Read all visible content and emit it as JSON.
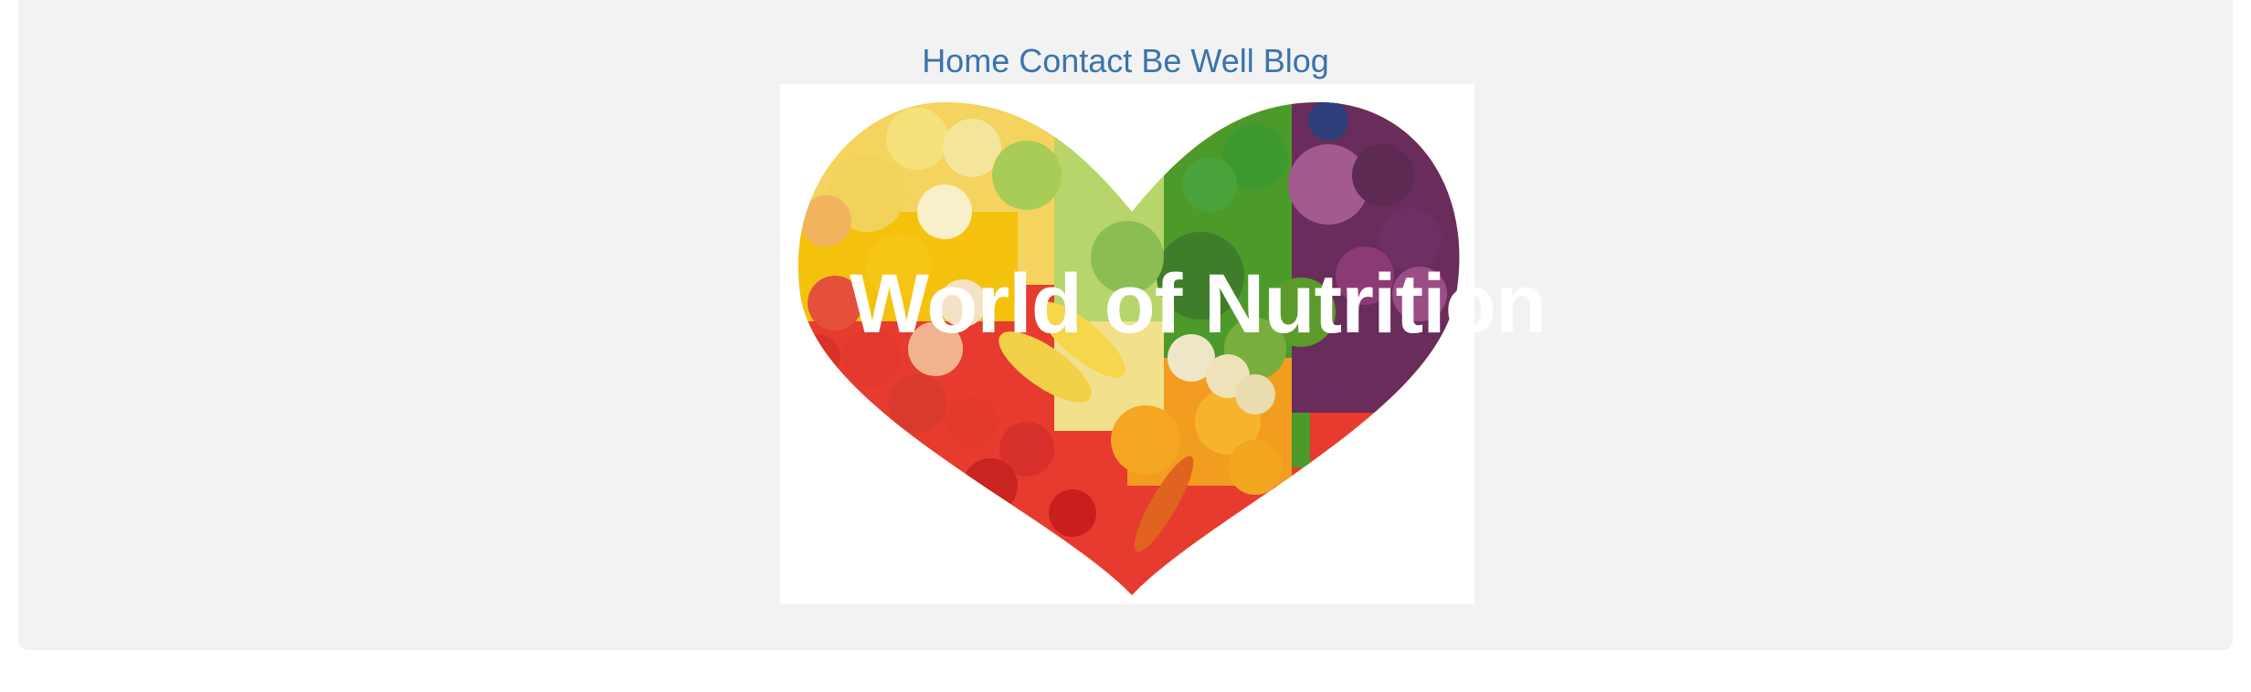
{
  "nav": {
    "home_label": "Home",
    "contact_label": "Contact",
    "bewell_label": "Be Well",
    "blog_label": "Blog"
  },
  "hero": {
    "title": "World of Nutrition",
    "image_icon": "fruit-vegetable-heart-image"
  },
  "colors": {
    "jumbotron_bg": "#f2f2f2",
    "link": "#3b73ad",
    "title_text": "#ffffff"
  }
}
